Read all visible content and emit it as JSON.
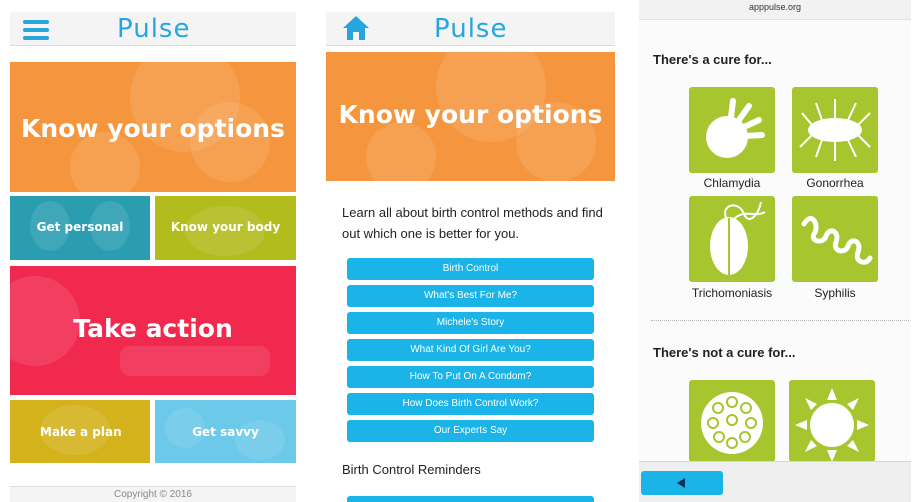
{
  "panel1": {
    "brand": "Pulse",
    "tiles": {
      "know_options": "Know your options",
      "get_personal": "Get personal",
      "know_body": "Know your body",
      "take_action": "Take action",
      "make_plan": "Make a plan",
      "get_savvy": "Get savvy"
    },
    "footer": "Copyright © 2016"
  },
  "panel2": {
    "brand": "Pulse",
    "banner": "Know your options",
    "intro": "Learn all about birth control methods and find out which one is better for you.",
    "buttons": [
      "Birth Control",
      "What's Best For Me?",
      "Michele's Story",
      "What Kind Of Girl Are You?",
      "How To Put On A Condom?",
      "How Does Birth Control Work?",
      "Our Experts Say"
    ],
    "section": "Birth Control Reminders"
  },
  "panel3": {
    "url": "apppulse.org",
    "cure_heading": "There's a cure for...",
    "cure_items": [
      "Chlamydia",
      "Gonorrhea",
      "Trichomoniasis",
      "Syphilis"
    ],
    "no_cure_heading": "There's not a cure for..."
  },
  "colors": {
    "brand_blue": "#27a6dd",
    "button_blue": "#1ab4e8",
    "orange": "#f5963e",
    "teal": "#2a9db0",
    "olive": "#b3bc1d",
    "pink": "#f1294f",
    "mustard": "#d4b21c",
    "sky": "#6cc9e9",
    "disease_green": "#a7c52e"
  },
  "icons": [
    "menu-icon",
    "home-icon",
    "back-arrow-icon"
  ]
}
